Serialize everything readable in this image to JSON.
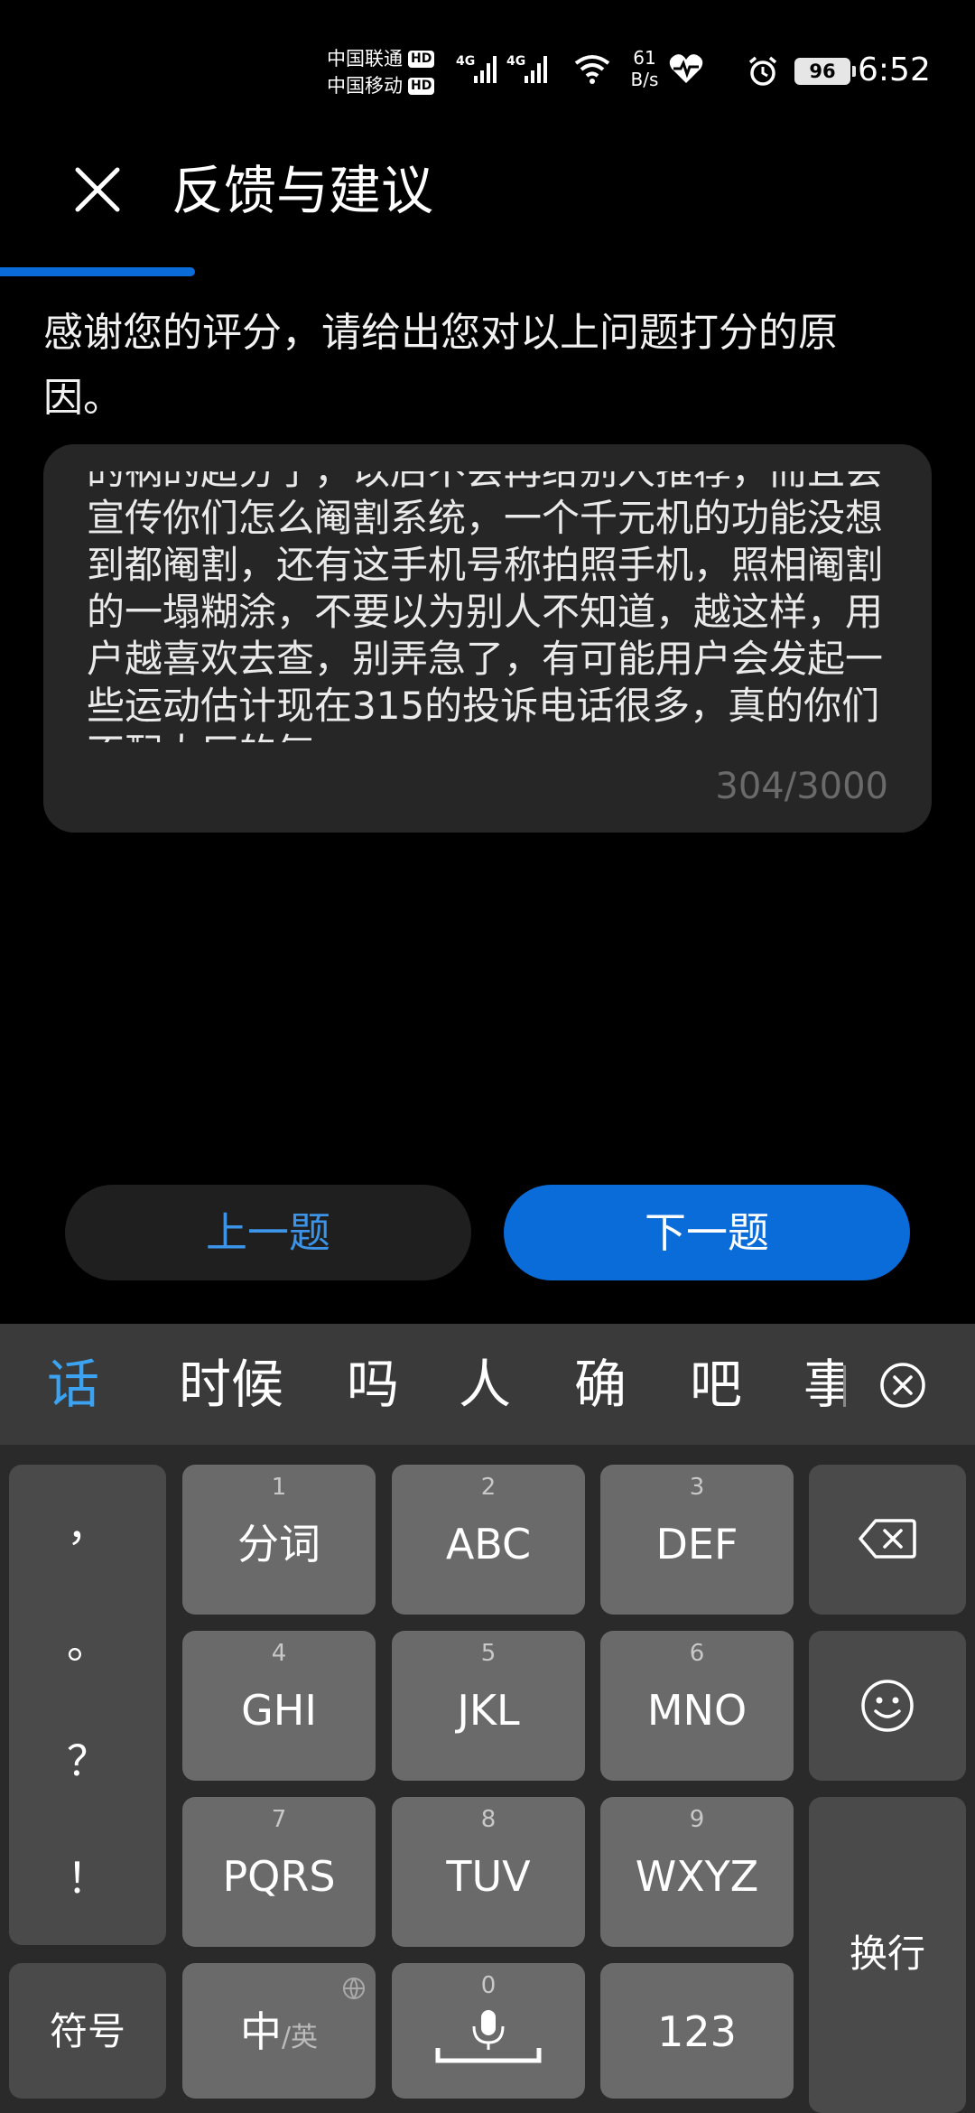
{
  "status_bar": {
    "carrier1": "中国联通",
    "carrier2": "中国移动",
    "hd": "HD",
    "net1": "4G",
    "net2": "4G",
    "speed_value": "61",
    "speed_unit": "B/s",
    "battery": "96",
    "time": "6:52"
  },
  "header": {
    "title": "反馈与建议",
    "close_icon": "close-icon"
  },
  "progress_fraction": 0.2,
  "prompt": "感谢您的评分，请给出您对以上问题打分的原因。",
  "feedback": {
    "text": "的祸的超分了，以后不会再给别人推荐，而且会宣传你们怎么阉割系统，一个千元机的功能没想到都阉割，还有这手机号称拍照手机，照相阉割的一塌糊涂，不要以为别人不知道，越这样，用户越喜欢去查，别弄急了，有可能用户会发起一些运动估计现在315的投诉电话很多，真的你们不配大厂的气",
    "counter": "304/3000"
  },
  "buttons": {
    "prev": "上一题",
    "next": "下一题"
  },
  "accent_color": "#0a6cd8",
  "keyboard": {
    "candidates": [
      "话",
      "时候",
      "吗",
      "人",
      "确",
      "吧",
      "事"
    ],
    "punctuation": [
      "，",
      "。",
      "？",
      "！"
    ],
    "keys": [
      {
        "num": "1",
        "label": "分词"
      },
      {
        "num": "2",
        "label": "ABC"
      },
      {
        "num": "3",
        "label": "DEF"
      },
      {
        "num": "4",
        "label": "GHI"
      },
      {
        "num": "5",
        "label": "JKL"
      },
      {
        "num": "6",
        "label": "MNO"
      },
      {
        "num": "7",
        "label": "PQRS"
      },
      {
        "num": "8",
        "label": "TUV"
      },
      {
        "num": "9",
        "label": "WXYZ"
      }
    ],
    "symbols": "符号",
    "lang_main": "中",
    "lang_alt": "/英",
    "space_num": "0",
    "num_key": "123",
    "enter": "换行",
    "backspace_icon": "backspace-icon",
    "emoji_icon": "emoji-icon",
    "mic_icon": "microphone-icon"
  }
}
